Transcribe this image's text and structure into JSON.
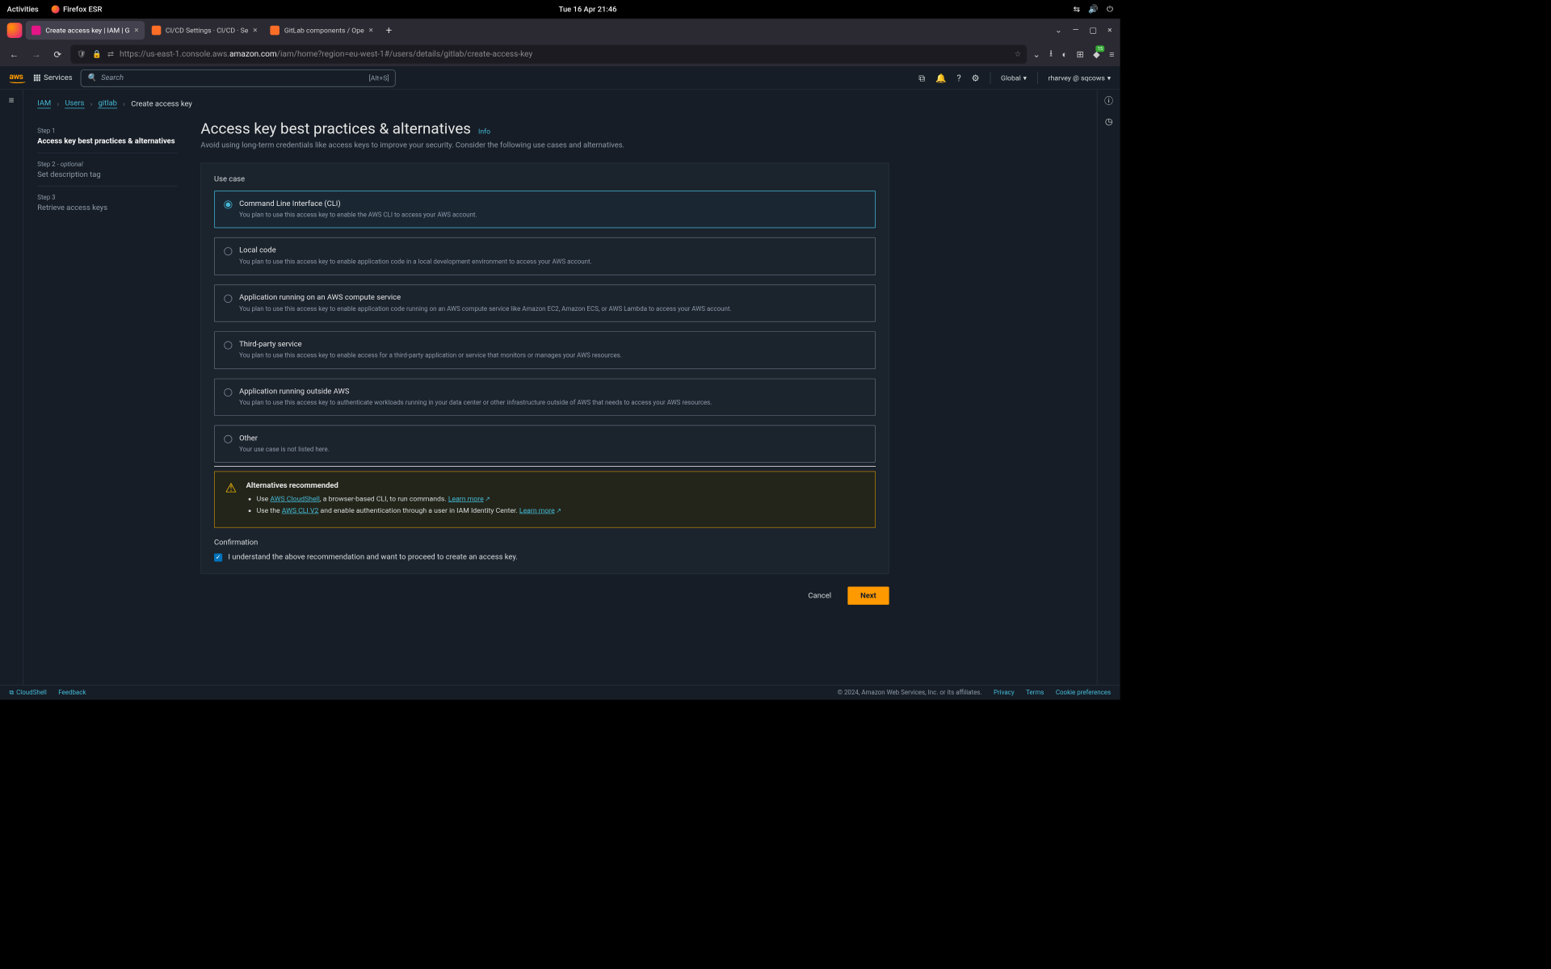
{
  "gnome": {
    "activities": "Activities",
    "app": "Firefox ESR",
    "clock": "Tue 16 Apr  21:46"
  },
  "tabs": [
    {
      "title": "Create access key | IAM | G",
      "favicon": "#e31587"
    },
    {
      "title": "CI/CD Settings · CI/CD · Se",
      "favicon": "#fc6d26"
    },
    {
      "title": "GitLab components / Ope",
      "favicon": "#fc6d26"
    }
  ],
  "url": {
    "prefix": "https://us-east-1.console.aws.",
    "host": "amazon.com",
    "path": "/iam/home?region=eu-west-1#/users/details/gitlab/create-access-key"
  },
  "aws_header": {
    "services": "Services",
    "search_placeholder": "Search",
    "search_hint": "[Alt+S]",
    "region": "Global",
    "user": "rharvey @ sqcows"
  },
  "breadcrumbs": {
    "items": [
      "IAM",
      "Users",
      "gitlab"
    ],
    "current": "Create access key"
  },
  "steps": [
    {
      "label": "Step 1",
      "title": "Access key best practices & alternatives",
      "active": true
    },
    {
      "label": "Step 2 - ",
      "optional": "optional",
      "title": "Set description tag",
      "active": false
    },
    {
      "label": "Step 3",
      "title": "Retrieve access keys",
      "active": false
    }
  ],
  "page": {
    "heading": "Access key best practices & alternatives",
    "info": "Info",
    "subheading": "Avoid using long-term credentials like access keys to improve your security. Consider the following use cases and alternatives.",
    "usecase_label": "Use case",
    "options": [
      {
        "title": "Command Line Interface (CLI)",
        "desc": "You plan to use this access key to enable the AWS CLI to access your AWS account.",
        "selected": true
      },
      {
        "title": "Local code",
        "desc": "You plan to use this access key to enable application code in a local development environment to access your AWS account.",
        "selected": false
      },
      {
        "title": "Application running on an AWS compute service",
        "desc": "You plan to use this access key to enable application code running on an AWS compute service like Amazon EC2, Amazon ECS, or AWS Lambda to access your AWS account.",
        "selected": false
      },
      {
        "title": "Third-party service",
        "desc": "You plan to use this access key to enable access for a third-party application or service that monitors or manages your AWS resources.",
        "selected": false
      },
      {
        "title": "Application running outside AWS",
        "desc": "You plan to use this access key to authenticate workloads running in your data center or other infrastructure outside of AWS that needs to access your AWS resources.",
        "selected": false
      },
      {
        "title": "Other",
        "desc": "Your use case is not listed here.",
        "selected": false
      }
    ],
    "alert": {
      "title": "Alternatives recommended",
      "bullets": {
        "b1_pre": "Use ",
        "b1_link": "AWS CloudShell",
        "b1_post": ", a browser-based CLI, to run commands. ",
        "b1_learn": "Learn more",
        "b2_pre": "Use the ",
        "b2_link": "AWS CLI V2",
        "b2_post": " and enable authentication through a user in IAM Identity Center. ",
        "b2_learn": "Learn more"
      }
    },
    "confirmation": {
      "label": "Confirmation",
      "text": "I understand the above recommendation and want to proceed to create an access key."
    },
    "buttons": {
      "cancel": "Cancel",
      "next": "Next"
    }
  },
  "footer": {
    "cloudshell": "CloudShell",
    "feedback": "Feedback",
    "copyright": "© 2024, Amazon Web Services, Inc. or its affiliates.",
    "privacy": "Privacy",
    "terms": "Terms",
    "cookies": "Cookie preferences"
  }
}
